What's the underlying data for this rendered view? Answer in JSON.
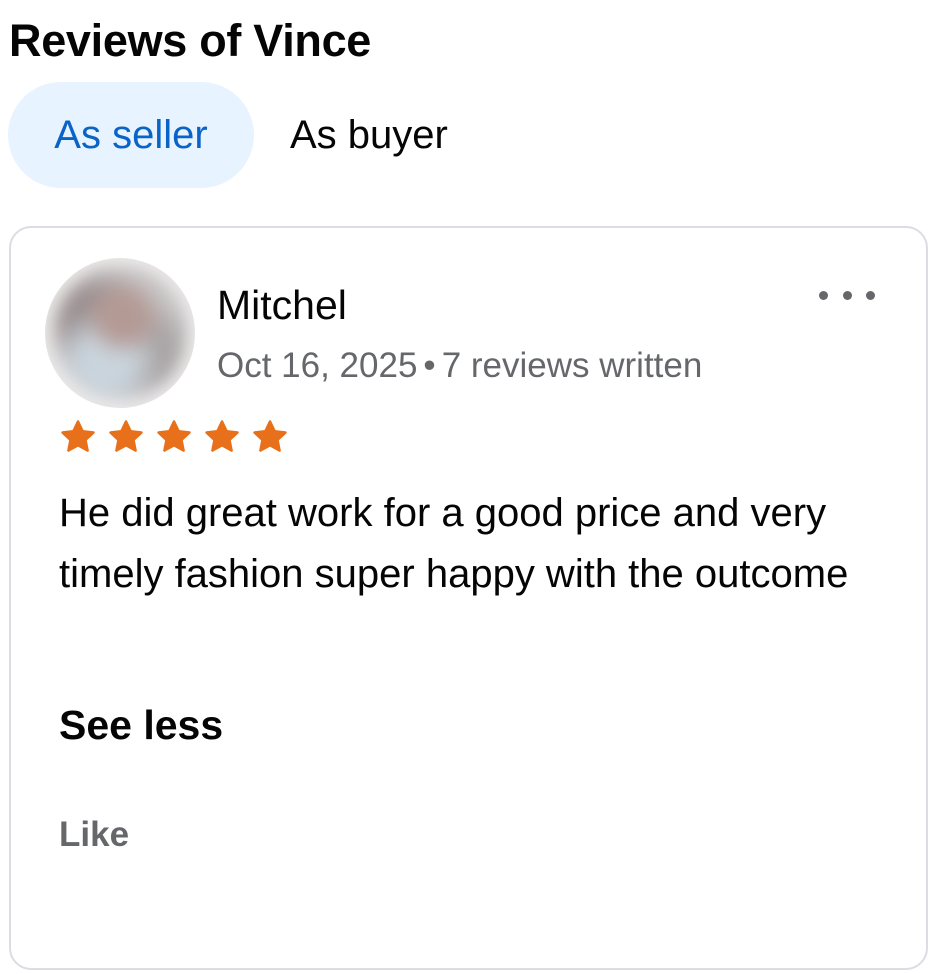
{
  "page": {
    "title": "Reviews of Vince"
  },
  "tabs": [
    {
      "label": "As seller",
      "active": true
    },
    {
      "label": "As buyer",
      "active": false
    }
  ],
  "review": {
    "reviewer_name": "Mitchel",
    "date": "Oct 16, 2025",
    "separator": "•",
    "reviews_written": "7 reviews written",
    "rating": 5,
    "rating_max": 5,
    "text": "He did great work for a good price and very timely fashion super happy with the outcome",
    "see_less_label": "See less",
    "like_label": "Like",
    "more_icon": "more-horizontal-icon",
    "avatar": "blurred-avatar"
  },
  "colors": {
    "accent": "#0a64c8",
    "active_tab_bg": "#e7f3ff",
    "star": "#e8701a",
    "secondary_text": "#65676b",
    "card_border": "#dadde1"
  }
}
